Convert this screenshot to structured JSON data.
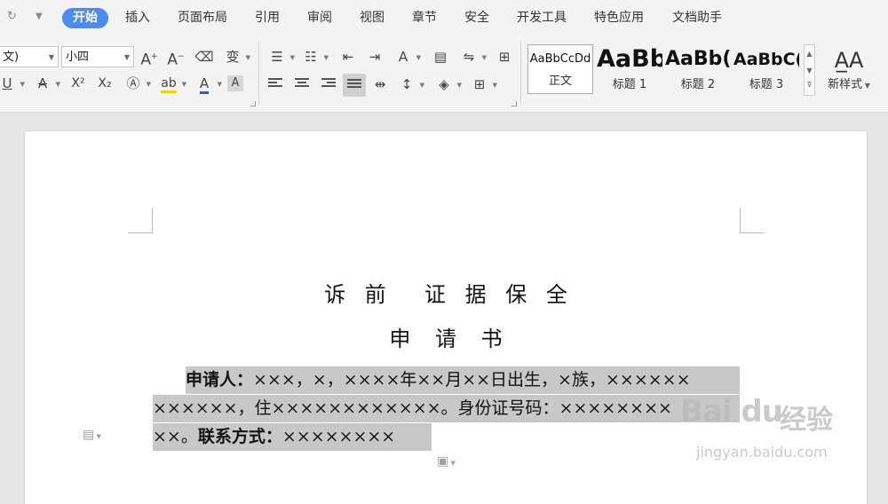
{
  "quick_access": {
    "redo_icon": "redo-icon",
    "more_icon": "chevron-down-icon"
  },
  "menu_tabs": [
    {
      "label": "开始",
      "active": true
    },
    {
      "label": "插入"
    },
    {
      "label": "页面布局"
    },
    {
      "label": "引用"
    },
    {
      "label": "审阅"
    },
    {
      "label": "视图"
    },
    {
      "label": "章节"
    },
    {
      "label": "安全"
    },
    {
      "label": "开发工具"
    },
    {
      "label": "特色应用"
    },
    {
      "label": "文档助手"
    }
  ],
  "font": {
    "name_value": "文)",
    "size_value": "小四"
  },
  "styles": [
    {
      "preview": "AaBbCcDd",
      "name": "正文",
      "selected": true
    },
    {
      "preview": "AaBb",
      "name": "标题 1"
    },
    {
      "preview": "AaBb(",
      "name": "标题 2"
    },
    {
      "preview": "AaBbC(",
      "name": "标题 3"
    }
  ],
  "new_style_label": "新样式",
  "document": {
    "title_line1": "诉 前  证 据 保 全",
    "title_line2": "申 请 书",
    "applicant_label": "申请人：",
    "line1_text": "×××，×，××××年××月××日出生，×族，××××××",
    "line2_text": "××××××，住××××××××××××。身份证号码：××××××××",
    "line3_prefix": "××。",
    "contact_label": "联系方式：",
    "contact_value": "××××××××"
  },
  "watermark": {
    "logo": "Bai du",
    "cn": "经验",
    "url": "jingyan.baidu.com"
  },
  "colors": {
    "accent": "#4a8cf0",
    "font_color_bar": "#2b58d6",
    "highlight": "#c8c8c8"
  }
}
